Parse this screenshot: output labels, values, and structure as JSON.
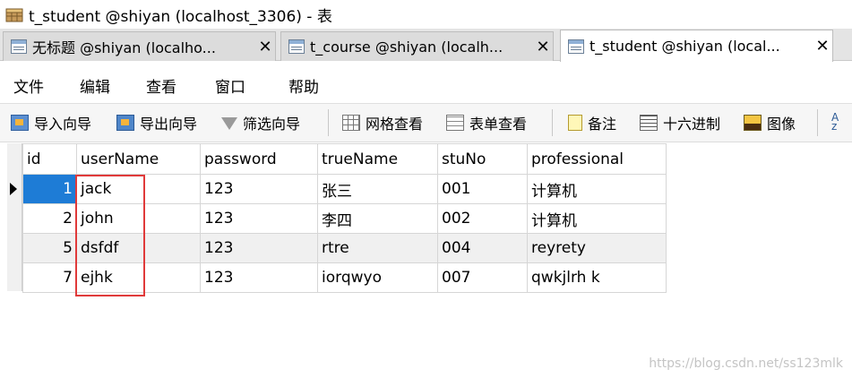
{
  "window": {
    "title": "t_student @shiyan (localhost_3306) - 表"
  },
  "tabs": [
    {
      "label": "无标题 @shiyan (localho...",
      "active": false
    },
    {
      "label": "t_course @shiyan (localh...",
      "active": false
    },
    {
      "label": "t_student @shiyan (local...",
      "active": true
    }
  ],
  "tab_close_glyph": "✕",
  "menu": [
    "文件",
    "编辑",
    "查看",
    "窗口",
    "帮助"
  ],
  "toolbar": [
    {
      "label": "导入向导",
      "icon": "import-icon"
    },
    {
      "label": "导出向导",
      "icon": "export-icon"
    },
    {
      "label": "筛选向导",
      "icon": "filter-icon"
    },
    {
      "label": "网格查看",
      "icon": "grid-view-icon"
    },
    {
      "label": "表单查看",
      "icon": "form-view-icon"
    },
    {
      "label": "备注",
      "icon": "memo-icon"
    },
    {
      "label": "十六进制",
      "icon": "hex-icon"
    },
    {
      "label": "图像",
      "icon": "image-icon"
    }
  ],
  "table": {
    "columns": [
      "id",
      "userName",
      "password",
      "trueName",
      "stuNo",
      "professional"
    ],
    "rows": [
      [
        "1",
        "jack",
        "123",
        "张三",
        "001",
        "计算机"
      ],
      [
        "2",
        "john",
        "123",
        "李四",
        "002",
        "计算机"
      ],
      [
        "5",
        "dsfdf",
        "123",
        "rtre",
        "004",
        "reyrety"
      ],
      [
        "7",
        "ejhk",
        "123",
        "iorqwyo",
        "007",
        "qwkjlrh k"
      ]
    ],
    "selected_row": 0
  },
  "watermark": "https://blog.csdn.net/ss123mlk",
  "colors": {
    "selection": "#1e7cd6",
    "annotation": "#e03a3a"
  }
}
